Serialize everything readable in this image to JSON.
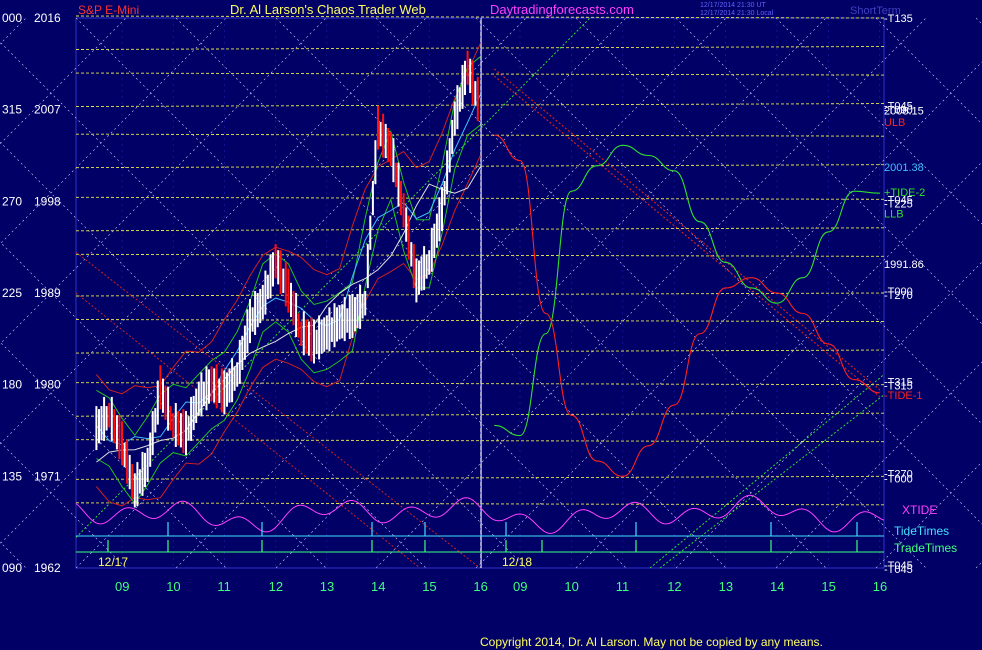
{
  "header": {
    "symbol": "S&P E-Mini",
    "title": "Dr. Al Larson's Chaos Trader Web",
    "site": "Daytradingforecasts.com",
    "stamp1": "12/17/2014 21:30 UT",
    "stamp2": "12/17/2014 21:30 Local",
    "brand": "ShortTerm"
  },
  "footer": {
    "copyright": "Copyright 2014, Dr. Al Larson. May not be copied by any means."
  },
  "colors": {
    "background": "#000066",
    "frame": "#3030d0",
    "level_line": "#e8e84a",
    "price_bar": "#ffffff",
    "down_bar": "#ff1010",
    "band_green": "#20c020",
    "band_red": "#d02020",
    "ma_cyan": "#40c0ff",
    "ma_white": "#e0e0e0",
    "xtide": "#ff40ff",
    "tidetimes": "#40e0ff",
    "tradetimes": "#40ff80",
    "forecast_green": "#30e030",
    "forecast_red": "#ff2020"
  },
  "chart_data": {
    "type": "line",
    "ylim": [
      1962,
      2016
    ],
    "y_ticks": [
      {
        "deg": "000",
        "price": 2016
      },
      {
        "deg": "315",
        "price": 2007
      },
      {
        "deg": "270",
        "price": 1998
      },
      {
        "deg": "225",
        "price": 1989
      },
      {
        "deg": "180",
        "price": 1980
      },
      {
        "deg": "135",
        "price": 1971
      },
      {
        "deg": "090",
        "price": 1962
      }
    ],
    "x_ticks_day1": [
      "09",
      "10",
      "11",
      "12",
      "13",
      "14",
      "15",
      "16"
    ],
    "x_ticks_day2": [
      "09",
      "10",
      "11",
      "12",
      "13",
      "14",
      "15",
      "16"
    ],
    "date_labels": [
      "12/17",
      "12/18"
    ],
    "right_labels": [
      {
        "text": "T135",
        "price": 2016,
        "color": "#ffffff"
      },
      {
        "text": "T045",
        "price": 2007.4,
        "color": "#ffffff"
      },
      {
        "text": "T090",
        "price": 2007.0,
        "color": "#ffffff"
      },
      {
        "text": "2008.15",
        "price": 2006.9,
        "color": "#ffffff"
      },
      {
        "text": "ULB",
        "price": 2005.8,
        "color": "#ff2020"
      },
      {
        "text": "2001.38",
        "price": 2001.38,
        "color": "#40c0ff"
      },
      {
        "text": "+TIDE-2",
        "price": 1998.9,
        "color": "#30e030"
      },
      {
        "text": "T045",
        "price": 1998.2,
        "color": "#ffffff"
      },
      {
        "text": "T225",
        "price": 1997.8,
        "color": "#ffffff"
      },
      {
        "text": "LLB",
        "price": 1996.8,
        "color": "#30e030"
      },
      {
        "text": "1991.86",
        "price": 1991.86,
        "color": "#ffffff"
      },
      {
        "text": "T000",
        "price": 1989.2,
        "color": "#ffffff"
      },
      {
        "text": "T270",
        "price": 1988.8,
        "color": "#ffffff"
      },
      {
        "text": "T315",
        "price": 1980.3,
        "color": "#ffffff"
      },
      {
        "text": "T315",
        "price": 1979.9,
        "color": "#ffffff"
      },
      {
        "text": "-TIDE-1",
        "price": 1979.0,
        "color": "#ff2020"
      },
      {
        "text": "T270",
        "price": 1971.3,
        "color": "#ffffff"
      },
      {
        "text": "T000",
        "price": 1970.8,
        "color": "#ffffff"
      },
      {
        "text": "T045",
        "price": 1962.3,
        "color": "#ffffff"
      },
      {
        "text": "T045",
        "price": 1961.9,
        "color": "#ffffff"
      }
    ],
    "legend": [
      {
        "text": "XTIDE",
        "color": "#ff40ff"
      },
      {
        "text": "TideTimes",
        "color": "#40e0ff"
      },
      {
        "text": "TradeTimes",
        "color": "#40ff80"
      }
    ],
    "levels": [
      2016,
      2013.2,
      2010.4,
      2007.6,
      2004.4,
      2001.6,
      1998.2,
      1995.4,
      1992.6,
      1989.0,
      1986.2,
      1983.4,
      1980.0,
      1977.2,
      1974.4,
      1971.0,
      1968.2
    ],
    "price_series": {
      "name": "Close",
      "hours": [
        8.5,
        8.75,
        9.0,
        9.25,
        9.5,
        9.75,
        10.0,
        10.25,
        10.5,
        10.75,
        11.0,
        11.25,
        11.5,
        11.75,
        12.0,
        12.25,
        12.5,
        12.75,
        13.0,
        13.25,
        13.5,
        13.75,
        14.0,
        14.25,
        14.5,
        14.75,
        15.0,
        15.25,
        15.5,
        15.75,
        16.0
      ],
      "values": [
        1975.5,
        1977,
        1974,
        1969.5,
        1972,
        1979.5,
        1976,
        1975,
        1978.5,
        1980,
        1979,
        1981,
        1986,
        1988,
        1992,
        1989,
        1985,
        1984,
        1985,
        1986,
        1986.5,
        1988,
        2005,
        2003,
        1997,
        1990,
        1992,
        1997,
        2006,
        2011,
        2007
      ]
    },
    "forecast_series": [
      {
        "name": "+TIDE-2",
        "hours": [
          8.5,
          9,
          9.5,
          10,
          10.5,
          11,
          11.5,
          12,
          12.5,
          13,
          13.5,
          14,
          14.5,
          15,
          15.5,
          16
        ],
        "values": [
          1976,
          1975,
          1985,
          1999,
          2001.5,
          2003.5,
          2002.5,
          2001,
          1996,
          1992,
          1989.5,
          1988,
          1990.5,
          1995,
          1999,
          1998.8
        ]
      },
      {
        "name": "-TIDE-1",
        "hours": [
          8.5,
          9,
          9.5,
          10,
          10.5,
          11,
          11.5,
          12,
          12.5,
          13,
          13.5,
          14,
          14.5,
          15,
          15.5,
          16
        ],
        "values": [
          2004.5,
          2002,
          1987,
          1977,
          1972.5,
          1971,
          1974,
          1978,
          1985,
          1989.5,
          1990.5,
          1989,
          1987,
          1984,
          1980.5,
          1979.2
        ]
      }
    ],
    "diagonal_forecast": {
      "name": "ULB/LLB channel",
      "hours": [
        8.5,
        16
      ],
      "values": [
        2011,
        1979.5
      ]
    }
  }
}
